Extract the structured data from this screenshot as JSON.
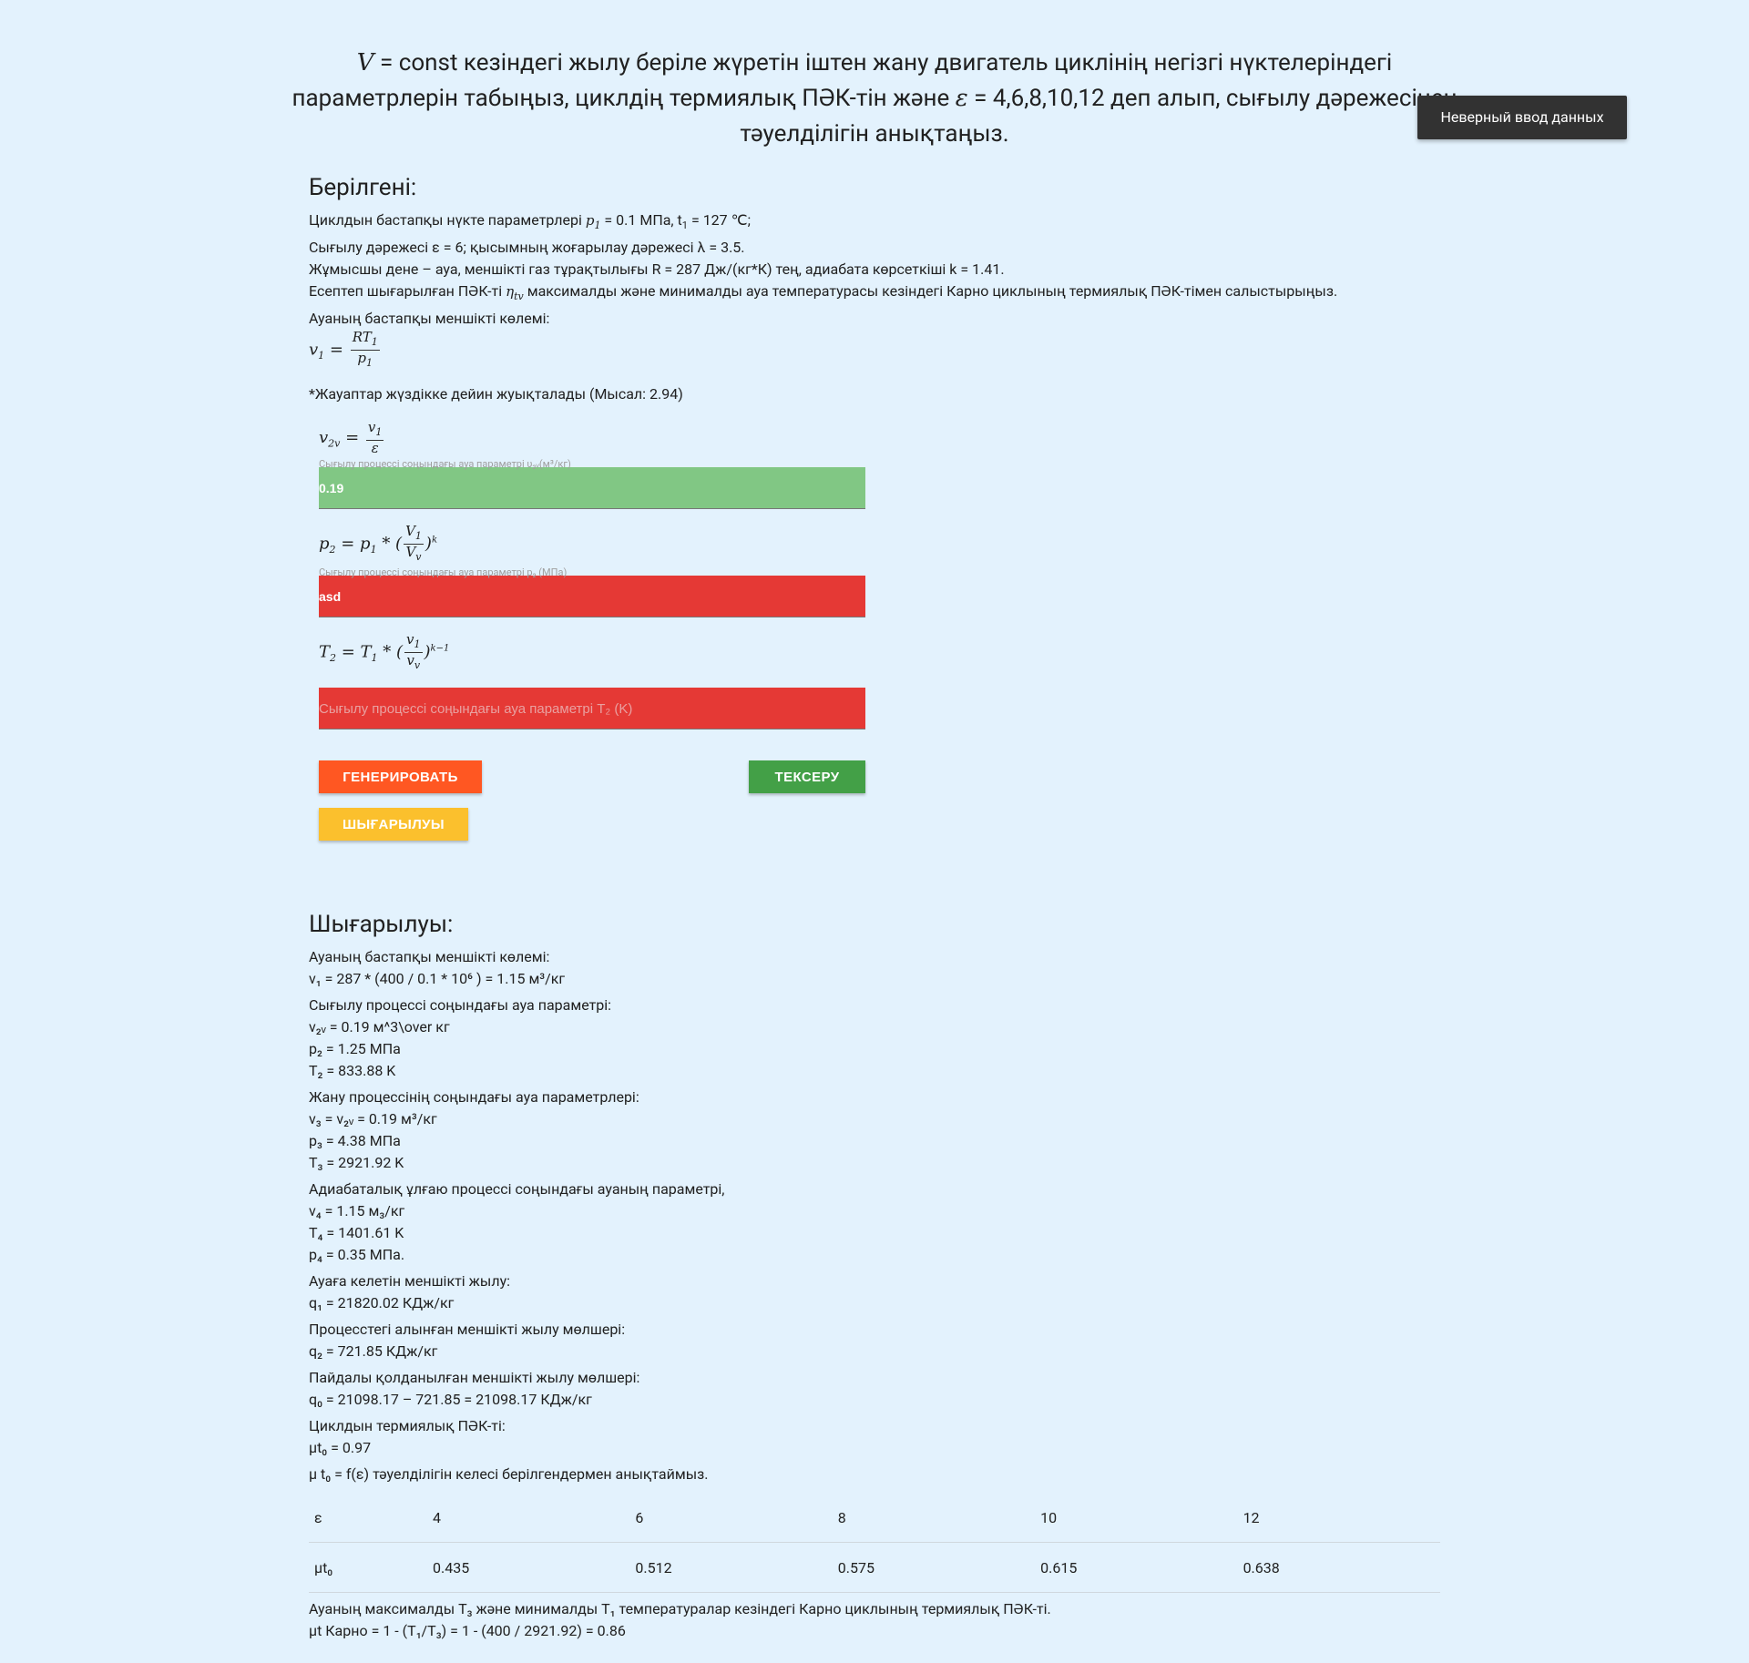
{
  "header": {
    "title_var": "V",
    "title_l1": " = const кезіндегі жылу беріле жүретін іштен жану двигатель циклінің негізгі нүктелеріндегі",
    "title_l2a": "параметрлерін табыңыз, циклдің термиялық ПӘК-тін және ",
    "title_eps": "ε",
    "title_l2b": " = 4,6,8,10,12 деп алып, сығылу дәрежесінен",
    "title_l3": "тәуелділігін анықтаңыз."
  },
  "toast": {
    "text": "Неверный ввод данных"
  },
  "given": {
    "heading": "Берілгені:",
    "l1a": "Циклдын бастапқы нүкте параметрлері ",
    "l1b": " = 0.1 МПа, t",
    "l1c": " = 127 ℃;",
    "l2": "Сығылу дәрежесі ε = 6; қысымның жоғарылау дәрежесі λ = 3.5.",
    "l3": "Жұмысшы дене – ауа, меншікті газ тұрақтылығы R = 287 Дж/(кг*К) тең, адиабата көрсеткіші k = 1.41.",
    "l4a": "Есептеп шығарылған ПӘК-ті ",
    "l4b": " максималды және минималды ауа температурасы кезіндегі Карно циклының термиялық ПӘК-тімен салыстырыңыз.",
    "l5": "Ауаның бастапқы меншікті көлемі:"
  },
  "note": "*Жауаптар жүздікке дейин жуықталады (Мысал: 2.94)",
  "fields": {
    "v2v_label": "Сығылу процессі соңындағы ауа параметрі υ₂ᵥ(м³/кг)",
    "v2v_value": "0.19",
    "p2_label": "Сығылу процессі соңындағы ауа параметрі p₂ (МПа)",
    "p2_value": "asd",
    "t2_placeholder": "Сығылу процессі соңындағы ауа параметрі T₂ (K)"
  },
  "buttons": {
    "generate": "ГЕНЕРИРОВАТЬ",
    "check": "ТЕКСЕРУ",
    "solution": "ШЫҒАРЫЛУЫ"
  },
  "solution": {
    "heading": "Шығарылуы:",
    "b1_title": "Ауаның бастапқы меншікті көлемі:",
    "b1_l1": "v₁ = 287 * (400 / 0.1 * 10⁶ ) = 1.15 м³/кг",
    "b2_title": "Сығылу процессі соңындағы ауа параметрі:",
    "b2_l1": "v₂ᵥ = 0.19 м^3\\over кг",
    "b2_l2": "p₂ = 1.25 МПа",
    "b2_l3": "T₂ = 833.88 K",
    "b3_title": "Жану процессінің соңындағы ауа параметрлері:",
    "b3_l1": "v₃ = v₂ᵥ = 0.19 м³/кг",
    "b3_l2": "p₃ = 4.38 МПа",
    "b3_l3": "T₃ = 2921.92 K",
    "b4_title": "Адиабаталық ұлғаю процессі соңындағы ауаның параметрі,",
    "b4_l1": "v₄ = 1.15 м₃/кг",
    "b4_l2": "T₄ = 1401.61 K",
    "b4_l3": "p₄ = 0.35 МПа.",
    "b5_title": "Ауаға келетін меншікті жылу:",
    "b5_l1": "q₁ = 21820.02 КДж/кг",
    "b6_title": "Процесстегі алынған меншікті жылу мөлшері:",
    "b6_l1": "q₂ = 721.85 КДж/кг",
    "b7_title": "Пайдалы қолданылған меншікті жылу мөлшері:",
    "b7_l1": "q₀ = 21098.17 – 721.85 = 21098.17 КДж/кг",
    "b8_title": "Циклдын термиялық ПӘК-ті:",
    "b8_l1": "μt₀ = 0.97",
    "b9_title": "μ t₀ = f(ε) тәуелділігін келесі берілгендермен анықтаймыз.",
    "table": {
      "row1_head": "ε",
      "row1": [
        "4",
        "6",
        "8",
        "10",
        "12"
      ],
      "row2_head": "μt₀",
      "row2": [
        "0.435",
        "0.512",
        "0.575",
        "0.615",
        "0.638"
      ]
    },
    "f_title": "Ауаның максималды T₃ және минималды T₁ температуралар кезіндегі Карно циклының термиялық ПӘК-ті.",
    "f_l1": "μt Карно = 1 - (T₁/T₃) = 1 - (400 / 2921.92) = 0.86"
  }
}
